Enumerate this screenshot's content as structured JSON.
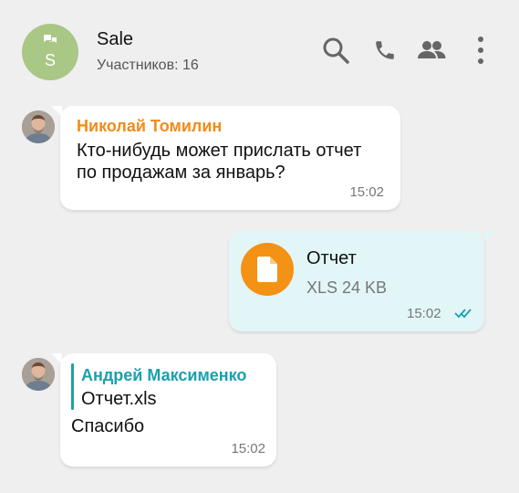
{
  "chat": {
    "avatar_letter": "S",
    "title": "Sale",
    "subtitle": "Участников: 16"
  },
  "header_icons": [
    "search-icon",
    "phone-icon",
    "members-icon",
    "more-vertical-icon"
  ],
  "messages": [
    {
      "sender": "Николай Томилин",
      "sender_color": "#f08c1a",
      "text_line1": "Кто-нибудь может прислать отчет",
      "text_line2": "по продажам за январь?",
      "time": "15:02"
    },
    {
      "file_name": "Отчет",
      "file_meta": "XLS 24 KB",
      "time": "15:02",
      "status": "read"
    },
    {
      "sender": "Андрей Максименко",
      "sender_color": "#1aa0ae",
      "reply_file": "Отчет.xls",
      "text": "Спасибо",
      "time": "15:02"
    }
  ]
}
